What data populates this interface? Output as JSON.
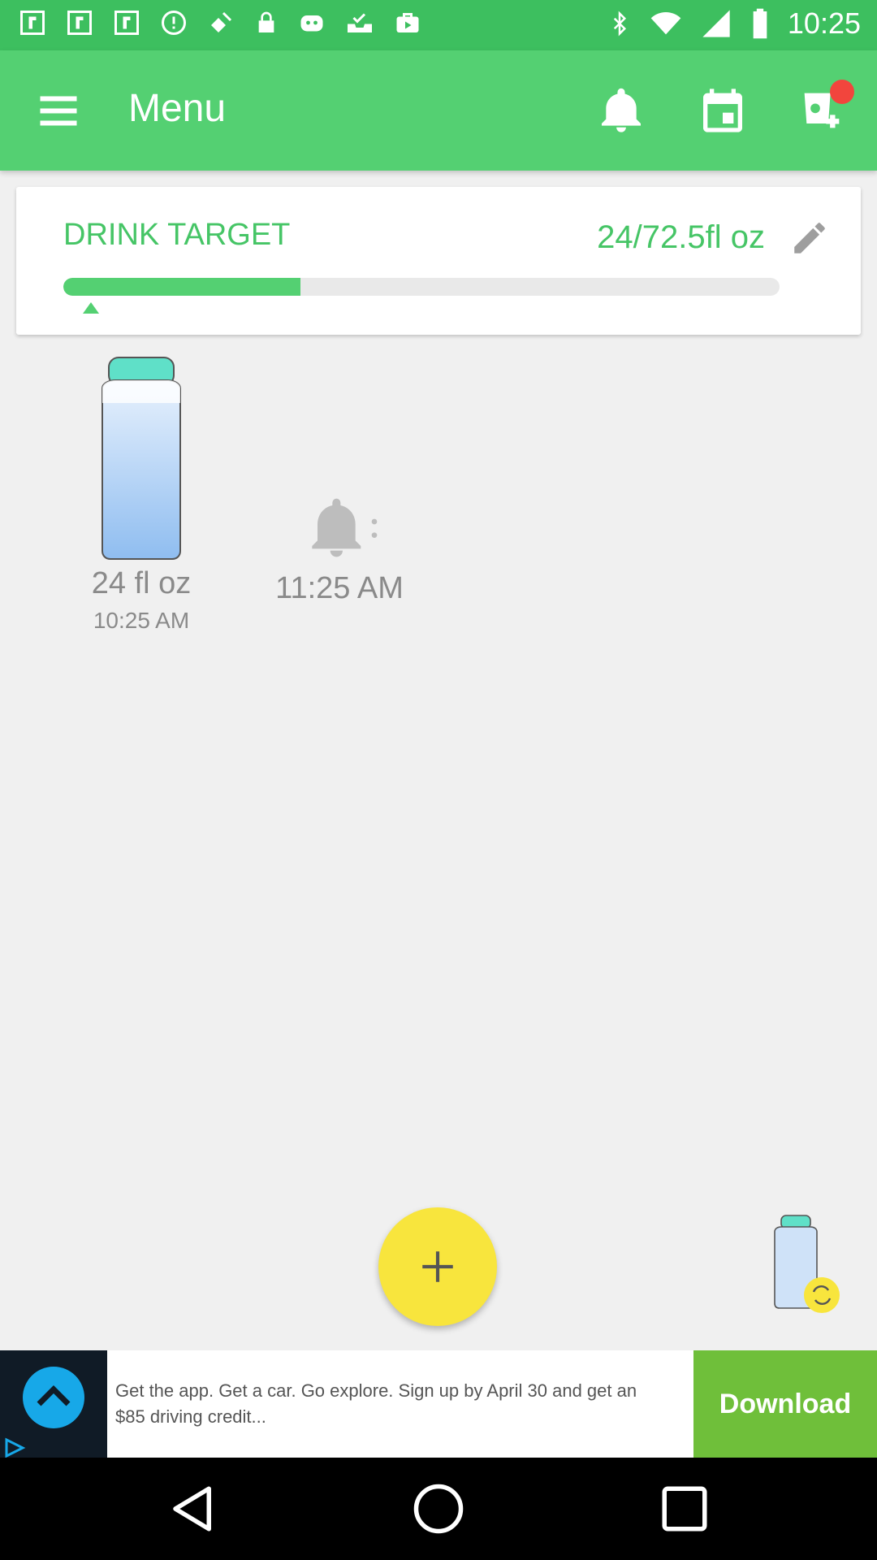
{
  "status_bar": {
    "time": "10:25",
    "left_icons": [
      "app-icon",
      "app-icon",
      "app-icon",
      "app-icon",
      "satellite-icon",
      "lock-icon",
      "game-controller-icon",
      "inbox-check-icon",
      "briefcase-icon"
    ],
    "right_icons": [
      "bluetooth-icon",
      "wifi-icon",
      "signal-icon",
      "battery-icon"
    ]
  },
  "app_bar": {
    "title": "Menu",
    "actions": [
      "bell-icon",
      "calendar-icon",
      "add-cup-icon"
    ]
  },
  "drink_target": {
    "label": "DRINK TARGET",
    "amount": "24/72.5fl oz",
    "progress": 0.331
  },
  "entries": [
    {
      "amount": "24 fl oz",
      "time": "10:25 AM"
    }
  ],
  "reminder": {
    "time": "11:25 AM"
  },
  "ad": {
    "text": "Get the app. Get a car. Go explore. Sign up by April 30 and get an $85 driving credit...",
    "cta": "Download"
  },
  "colors": {
    "status_bar": "#3dbf5f",
    "app_bar": "#54d072",
    "accent_green": "#46c566",
    "fab": "#f8e53d",
    "ad_button": "#6fbf3a"
  }
}
